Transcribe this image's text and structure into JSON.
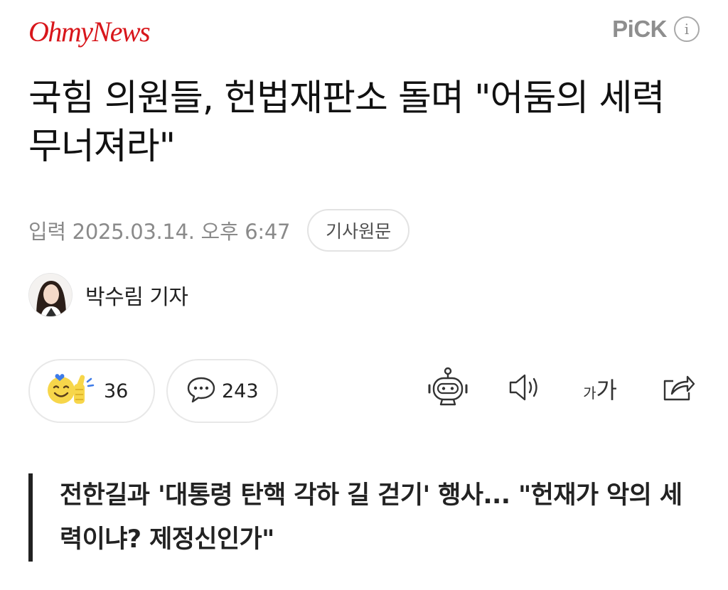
{
  "header": {
    "press_name": "OhmyNews",
    "pick_label": "PiCK",
    "info_icon": "info-icon"
  },
  "article": {
    "title": "국힘 의원들, 헌법재판소 돌며 \"어둠의 세력 무너져라\"",
    "date_text": "입력 2025.03.14. 오후 6:47",
    "origin_button_label": "기사원문",
    "reporter_name": "박수림 기자",
    "subtitle": "전한길과 '대통령 탄핵 각하 길 걷기' 행사... \"헌재가 악의 세력이냐? 제정신인가\""
  },
  "reactions": {
    "like_icon": "emoji-thumbs-up-icon",
    "like_count": "36",
    "comment_icon": "comment-bubble-icon",
    "comment_count": "243"
  },
  "toolbar": {
    "items": [
      "ai-summary-bot-icon",
      "audio-read-icon",
      "font-size-icon",
      "share-icon"
    ],
    "font_small": "가",
    "font_large": "가"
  },
  "colors": {
    "brand_red": "#d8161b",
    "meta_gray": "#8a8a8a",
    "border_gray": "#e6e6e6",
    "emoji_yellow": "#f7d64a",
    "emoji_blue": "#3e7be8"
  }
}
